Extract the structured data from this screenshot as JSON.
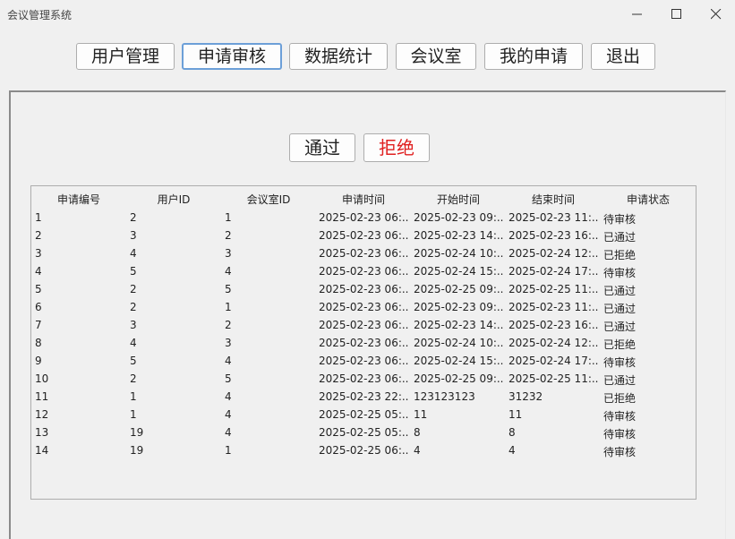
{
  "window": {
    "title": "会议管理系统"
  },
  "nav": [
    {
      "label": "用户管理"
    },
    {
      "label": "申请审核"
    },
    {
      "label": "数据统计"
    },
    {
      "label": "会议室"
    },
    {
      "label": "我的申请"
    },
    {
      "label": "退出"
    }
  ],
  "actions": {
    "approve": "通过",
    "reject": "拒绝",
    "reject_color": "#e02020"
  },
  "table": {
    "columns": [
      "申请编号",
      "用户ID",
      "会议室ID",
      "申请时间",
      "开始时间",
      "结束时间",
      "申请状态"
    ],
    "rows": [
      [
        "1",
        "2",
        "1",
        "2025-02-23 06:...",
        "2025-02-23 09:...",
        "2025-02-23 11:...",
        "待审核"
      ],
      [
        "2",
        "3",
        "2",
        "2025-02-23 06:...",
        "2025-02-23 14:...",
        "2025-02-23 16:...",
        "已通过"
      ],
      [
        "3",
        "4",
        "3",
        "2025-02-23 06:...",
        "2025-02-24 10:...",
        "2025-02-24 12:...",
        "已拒绝"
      ],
      [
        "4",
        "5",
        "4",
        "2025-02-23 06:...",
        "2025-02-24 15:...",
        "2025-02-24 17:...",
        "待审核"
      ],
      [
        "5",
        "2",
        "5",
        "2025-02-23 06:...",
        "2025-02-25 09:...",
        "2025-02-25 11:...",
        "已通过"
      ],
      [
        "6",
        "2",
        "1",
        "2025-02-23 06:...",
        "2025-02-23 09:...",
        "2025-02-23 11:...",
        "已通过"
      ],
      [
        "7",
        "3",
        "2",
        "2025-02-23 06:...",
        "2025-02-23 14:...",
        "2025-02-23 16:...",
        "已通过"
      ],
      [
        "8",
        "4",
        "3",
        "2025-02-23 06:...",
        "2025-02-24 10:...",
        "2025-02-24 12:...",
        "已拒绝"
      ],
      [
        "9",
        "5",
        "4",
        "2025-02-23 06:...",
        "2025-02-24 15:...",
        "2025-02-24 17:...",
        "待审核"
      ],
      [
        "10",
        "2",
        "5",
        "2025-02-23 06:...",
        "2025-02-25 09:...",
        "2025-02-25 11:...",
        "已通过"
      ],
      [
        "11",
        "1",
        "4",
        "2025-02-23 22:...",
        "123123123",
        "31232",
        "已拒绝"
      ],
      [
        "12",
        "1",
        "4",
        "2025-02-25 05:...",
        "11",
        "11",
        "待审核"
      ],
      [
        "13",
        "19",
        "4",
        "2025-02-25 05:...",
        "8",
        "8",
        "待审核"
      ],
      [
        "14",
        "19",
        "1",
        "2025-02-25 06:...",
        "4",
        "4",
        "待审核"
      ]
    ]
  }
}
